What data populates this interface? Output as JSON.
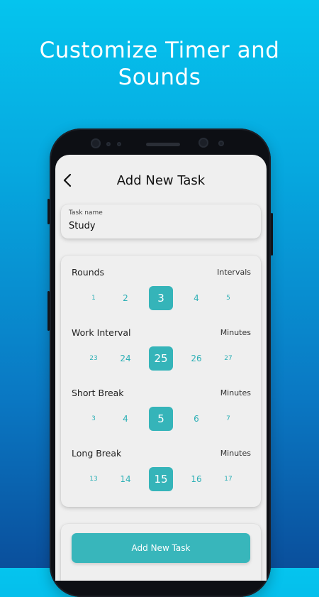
{
  "headline": {
    "line1": "Customize Timer and",
    "line2": "Sounds"
  },
  "header": {
    "title": "Add New Task",
    "back_icon": "chevron-left-icon"
  },
  "task": {
    "label": "Task name",
    "value": "Study"
  },
  "settings": {
    "rows": [
      {
        "title": "Rounds",
        "unit": "Intervals",
        "values": [
          "1",
          "2",
          "3",
          "4",
          "5"
        ],
        "selected_index": 2
      },
      {
        "title": "Work Interval",
        "unit": "Minutes",
        "values": [
          "23",
          "24",
          "25",
          "26",
          "27"
        ],
        "selected_index": 2
      },
      {
        "title": "Short Break",
        "unit": "Minutes",
        "values": [
          "3",
          "4",
          "5",
          "6",
          "7"
        ],
        "selected_index": 2
      },
      {
        "title": "Long Break",
        "unit": "Minutes",
        "values": [
          "13",
          "14",
          "15",
          "16",
          "17"
        ],
        "selected_index": 2
      }
    ]
  },
  "actions": {
    "add_label": "Add New Task"
  },
  "colors": {
    "accent": "#35b4b9",
    "background_top": "#05c4ee",
    "background_bottom": "#0a4f9c"
  }
}
